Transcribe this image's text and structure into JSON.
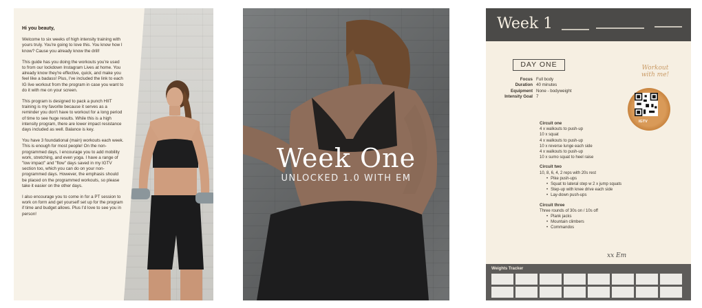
{
  "page1": {
    "greeting": "Hi you beauty,",
    "paragraphs": [
      "Welcome to six weeks of high intensity training with yours truly. You're going to love this. You know how I know? Cause you already know the drill!",
      "This guide has you doing the workouts you're used to from our lockdown Instagram Lives at home. You already know they're effective, quick, and make you feel like a badass! Plus, I've included the link to each IG live workout from the program in case you want to do it with me on your screen.",
      "This program is designed to pack a punch HIIT training is my favorite because it serves as a reminder you don't have to workout for a long period of time to see huge results. While this is a high intensity program, there are lower impact resistance days included as well. Balance is key.",
      "You have 3 foundational (main) workouts each week. This is enough for most people! On the non-programmed days, I encourage you to add mobility work, stretching, and even yoga. I have a range of \"low impact\" and \"flow\" days saved in my IGTV section too, which you can do on your non-programmed days. However, the emphasis should be placed on the programmed workouts, so please take it easier on the other days.",
      "I also encourage you to come in for a PT session to work on form and get yourself set up for the program if time and budget allows. Plus I'd love to see you in person!"
    ]
  },
  "page2": {
    "title": "Week One",
    "subtitle": "UNLOCKED 1.0 WITH EM"
  },
  "page3": {
    "header": "Week 1",
    "day": "DAY ONE",
    "info": [
      {
        "key": "Focus",
        "value": "Full body"
      },
      {
        "key": "Duration",
        "value": "40 minutes"
      },
      {
        "key": "Equipment",
        "value": "None - bodyweight"
      },
      {
        "key": "Intensity Goal",
        "value": "7"
      }
    ],
    "workout_with_me": "Workout with me!",
    "qr_label": "IGTV",
    "circuit_one_title": "Circuit one",
    "circuit_one": [
      "4 x walkouts to push-up",
      "10 x squat",
      "4 x walkouts to push-up",
      "10 x reverse lunge each side",
      "4 x walkouts to push-up",
      "10 x sumo squat to heel raise"
    ],
    "circuit_two_title": "Circuit two",
    "circuit_two_intro": "10, 8, 6, 4, 2 reps with 20s rest",
    "circuit_two": [
      "Pike push-ups",
      "Squat to lateral step w 2 x jump squats",
      "Step-up with knee drive each side",
      "Lay-down push-ups"
    ],
    "circuit_three_title": "Circuit three",
    "circuit_three_intro": "Three rounds of 30s on / 10s off",
    "circuit_three": [
      "Plank jacks",
      "Mountain climbers",
      "Commandos"
    ],
    "signoff": "xx Em",
    "tracker_label": "Weights Tracker"
  },
  "colors": {
    "cream": "#f6efe2",
    "charcoal": "#4b4a48",
    "accent": "#d99a58"
  }
}
